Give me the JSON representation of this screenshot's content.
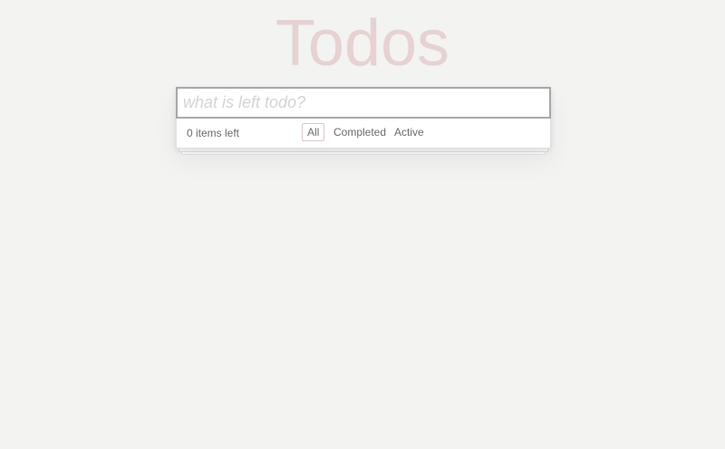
{
  "app": {
    "title": "Todos"
  },
  "new_todo": {
    "value": "",
    "placeholder": "what is left todo?"
  },
  "footer": {
    "items_left": "0 items left",
    "filters": [
      {
        "label": "All",
        "selected": true
      },
      {
        "label": "Completed",
        "selected": false
      },
      {
        "label": "Active",
        "selected": false
      }
    ]
  },
  "colors": {
    "background": "#f3f3f1",
    "title": "#e6d2d2",
    "input_border": "#a8a8a8",
    "selected_filter_border": "#d9c9c9"
  }
}
